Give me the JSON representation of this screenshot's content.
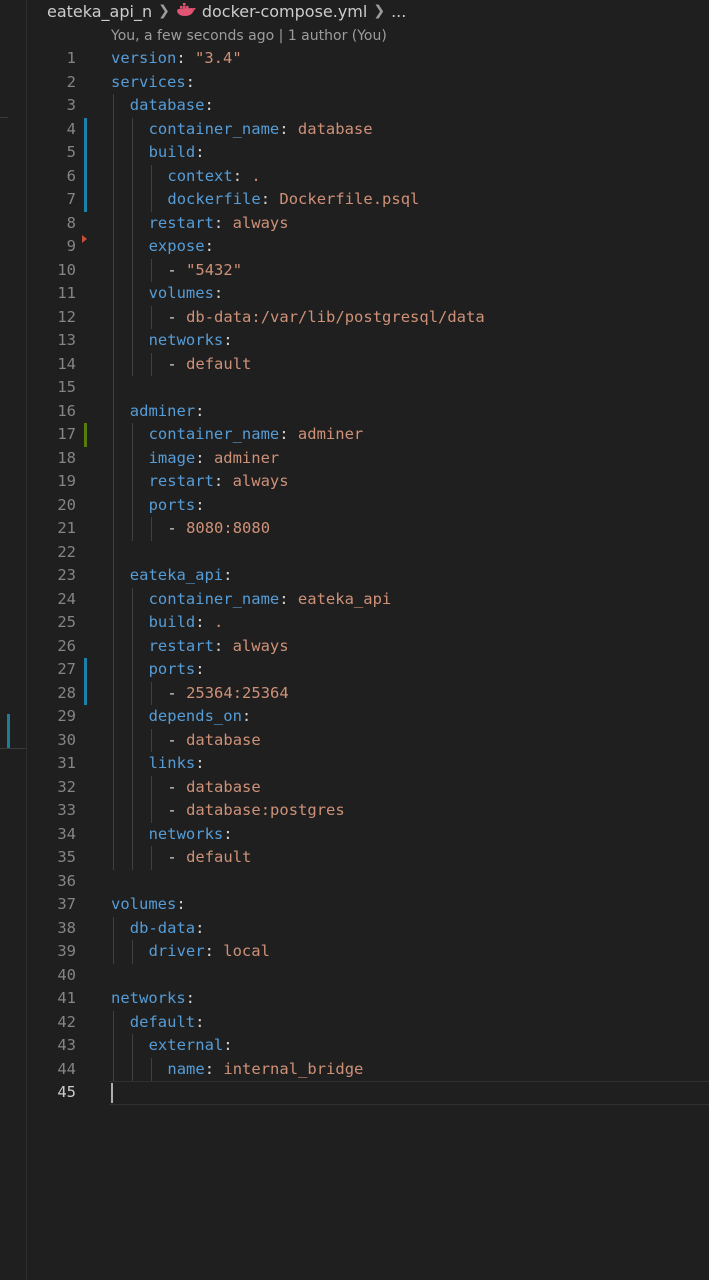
{
  "breadcrumb": {
    "folder": "eateka_api_n",
    "file": "docker-compose.yml",
    "more": "..."
  },
  "blame": "You, a few seconds ago | 1 author (You)",
  "lines": [
    {
      "n": "1",
      "indent": 0,
      "dash": false,
      "key": "version",
      "colon": true,
      "value": "\"3.4\"",
      "git": ""
    },
    {
      "n": "2",
      "indent": 0,
      "dash": false,
      "key": "services",
      "colon": true,
      "value": "",
      "git": ""
    },
    {
      "n": "3",
      "indent": 1,
      "dash": false,
      "key": "database",
      "colon": true,
      "value": "",
      "git": ""
    },
    {
      "n": "4",
      "indent": 2,
      "dash": false,
      "key": "container_name",
      "colon": true,
      "value": "database",
      "git": "mod"
    },
    {
      "n": "5",
      "indent": 2,
      "dash": false,
      "key": "build",
      "colon": true,
      "value": "",
      "git": "mod"
    },
    {
      "n": "6",
      "indent": 3,
      "dash": false,
      "key": "context",
      "colon": true,
      "value": ".",
      "git": "mod"
    },
    {
      "n": "7",
      "indent": 3,
      "dash": false,
      "key": "dockerfile",
      "colon": true,
      "value": "Dockerfile.psql",
      "git": "mod"
    },
    {
      "n": "8",
      "indent": 2,
      "dash": false,
      "key": "restart",
      "colon": true,
      "value": "always",
      "git": ""
    },
    {
      "n": "9",
      "indent": 2,
      "dash": false,
      "key": "expose",
      "colon": true,
      "value": "",
      "git": "del"
    },
    {
      "n": "10",
      "indent": 3,
      "dash": true,
      "key": "",
      "colon": false,
      "value": "\"5432\"",
      "git": ""
    },
    {
      "n": "11",
      "indent": 2,
      "dash": false,
      "key": "volumes",
      "colon": true,
      "value": "",
      "git": ""
    },
    {
      "n": "12",
      "indent": 3,
      "dash": true,
      "key": "",
      "colon": false,
      "value": "db-data:/var/lib/postgresql/data",
      "git": ""
    },
    {
      "n": "13",
      "indent": 2,
      "dash": false,
      "key": "networks",
      "colon": true,
      "value": "",
      "git": ""
    },
    {
      "n": "14",
      "indent": 3,
      "dash": true,
      "key": "",
      "colon": false,
      "value": "default",
      "git": ""
    },
    {
      "n": "15",
      "indent": 0,
      "dash": false,
      "key": "",
      "colon": false,
      "value": "",
      "git": ""
    },
    {
      "n": "16",
      "indent": 1,
      "dash": false,
      "key": "adminer",
      "colon": true,
      "value": "",
      "git": ""
    },
    {
      "n": "17",
      "indent": 2,
      "dash": false,
      "key": "container_name",
      "colon": true,
      "value": "adminer",
      "git": "add"
    },
    {
      "n": "18",
      "indent": 2,
      "dash": false,
      "key": "image",
      "colon": true,
      "value": "adminer",
      "git": ""
    },
    {
      "n": "19",
      "indent": 2,
      "dash": false,
      "key": "restart",
      "colon": true,
      "value": "always",
      "git": ""
    },
    {
      "n": "20",
      "indent": 2,
      "dash": false,
      "key": "ports",
      "colon": true,
      "value": "",
      "git": ""
    },
    {
      "n": "21",
      "indent": 3,
      "dash": true,
      "key": "",
      "colon": false,
      "value": "8080:8080",
      "git": ""
    },
    {
      "n": "22",
      "indent": 0,
      "dash": false,
      "key": "",
      "colon": false,
      "value": "",
      "git": ""
    },
    {
      "n": "23",
      "indent": 1,
      "dash": false,
      "key": "eateka_api",
      "colon": true,
      "value": "",
      "git": ""
    },
    {
      "n": "24",
      "indent": 2,
      "dash": false,
      "key": "container_name",
      "colon": true,
      "value": "eateka_api",
      "git": ""
    },
    {
      "n": "25",
      "indent": 2,
      "dash": false,
      "key": "build",
      "colon": true,
      "value": ".",
      "git": ""
    },
    {
      "n": "26",
      "indent": 2,
      "dash": false,
      "key": "restart",
      "colon": true,
      "value": "always",
      "git": ""
    },
    {
      "n": "27",
      "indent": 2,
      "dash": false,
      "key": "ports",
      "colon": true,
      "value": "",
      "git": "mod"
    },
    {
      "n": "28",
      "indent": 3,
      "dash": true,
      "key": "",
      "colon": false,
      "value": "25364:25364",
      "git": "mod"
    },
    {
      "n": "29",
      "indent": 2,
      "dash": false,
      "key": "depends_on",
      "colon": true,
      "value": "",
      "git": ""
    },
    {
      "n": "30",
      "indent": 3,
      "dash": true,
      "key": "",
      "colon": false,
      "value": "database",
      "git": ""
    },
    {
      "n": "31",
      "indent": 2,
      "dash": false,
      "key": "links",
      "colon": true,
      "value": "",
      "git": ""
    },
    {
      "n": "32",
      "indent": 3,
      "dash": true,
      "key": "",
      "colon": false,
      "value": "database",
      "git": ""
    },
    {
      "n": "33",
      "indent": 3,
      "dash": true,
      "key": "",
      "colon": false,
      "value": "database:postgres",
      "git": ""
    },
    {
      "n": "34",
      "indent": 2,
      "dash": false,
      "key": "networks",
      "colon": true,
      "value": "",
      "git": ""
    },
    {
      "n": "35",
      "indent": 3,
      "dash": true,
      "key": "",
      "colon": false,
      "value": "default",
      "git": ""
    },
    {
      "n": "36",
      "indent": 0,
      "dash": false,
      "key": "",
      "colon": false,
      "value": "",
      "git": ""
    },
    {
      "n": "37",
      "indent": 0,
      "dash": false,
      "key": "volumes",
      "colon": true,
      "value": "",
      "git": ""
    },
    {
      "n": "38",
      "indent": 1,
      "dash": false,
      "key": "db-data",
      "colon": true,
      "value": "",
      "git": ""
    },
    {
      "n": "39",
      "indent": 2,
      "dash": false,
      "key": "driver",
      "colon": true,
      "value": "local",
      "git": ""
    },
    {
      "n": "40",
      "indent": 0,
      "dash": false,
      "key": "",
      "colon": false,
      "value": "",
      "git": ""
    },
    {
      "n": "41",
      "indent": 0,
      "dash": false,
      "key": "networks",
      "colon": true,
      "value": "",
      "git": ""
    },
    {
      "n": "42",
      "indent": 1,
      "dash": false,
      "key": "default",
      "colon": true,
      "value": "",
      "git": ""
    },
    {
      "n": "43",
      "indent": 2,
      "dash": false,
      "key": "external",
      "colon": true,
      "value": "",
      "git": ""
    },
    {
      "n": "44",
      "indent": 3,
      "dash": false,
      "key": "name",
      "colon": true,
      "value": "internal_bridge",
      "git": ""
    },
    {
      "n": "45",
      "indent": 0,
      "dash": false,
      "key": "",
      "colon": false,
      "value": "",
      "git": "",
      "current": true
    }
  ]
}
